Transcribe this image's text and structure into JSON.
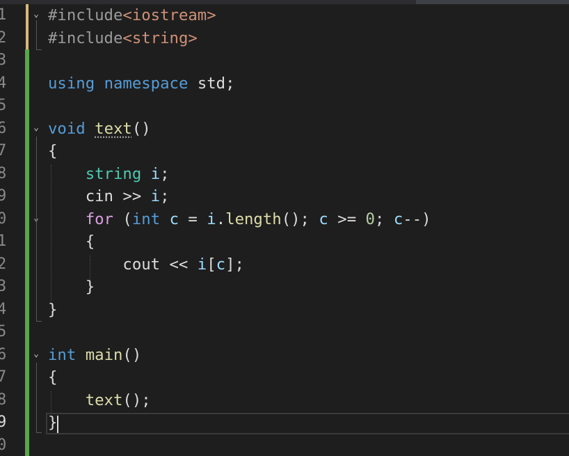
{
  "editor": {
    "language": "C++",
    "line_numbers": [
      "1",
      "2",
      "3",
      "4",
      "5",
      "6",
      "7",
      "8",
      "9",
      "0",
      "1",
      "2",
      "3",
      "4",
      "5",
      "6",
      "7",
      "8",
      "9",
      "0"
    ],
    "current_line_number_index": 18,
    "fold_toggle_glyph": "⌄",
    "lines": [
      [
        {
          "t": "#include",
          "c": "pp"
        },
        {
          "t": "<iostream>",
          "c": "include"
        }
      ],
      [
        {
          "t": "#include",
          "c": "pp"
        },
        {
          "t": "<string>",
          "c": "include"
        }
      ],
      [],
      [
        {
          "t": "using",
          "c": "kw"
        },
        {
          "t": " ",
          "c": "plain"
        },
        {
          "t": "namespace",
          "c": "kw"
        },
        {
          "t": " std;",
          "c": "plain"
        }
      ],
      [],
      [
        {
          "t": "void",
          "c": "kw"
        },
        {
          "t": " ",
          "c": "plain"
        },
        {
          "t": "text",
          "c": "fn squiggle"
        },
        {
          "t": "()",
          "c": "plain"
        }
      ],
      [
        {
          "t": "{",
          "c": "plain"
        }
      ],
      [
        {
          "t": "    ",
          "c": "plain"
        },
        {
          "t": "string",
          "c": "type"
        },
        {
          "t": " ",
          "c": "plain"
        },
        {
          "t": "i",
          "c": "var"
        },
        {
          "t": ";",
          "c": "plain"
        }
      ],
      [
        {
          "t": "    cin >> ",
          "c": "plain"
        },
        {
          "t": "i",
          "c": "var"
        },
        {
          "t": ";",
          "c": "plain"
        }
      ],
      [
        {
          "t": "    ",
          "c": "plain"
        },
        {
          "t": "for",
          "c": "ctrl"
        },
        {
          "t": " (",
          "c": "plain"
        },
        {
          "t": "int",
          "c": "kw"
        },
        {
          "t": " ",
          "c": "plain"
        },
        {
          "t": "c",
          "c": "var"
        },
        {
          "t": " = ",
          "c": "plain"
        },
        {
          "t": "i",
          "c": "var"
        },
        {
          "t": ".",
          "c": "plain"
        },
        {
          "t": "length",
          "c": "fn"
        },
        {
          "t": "(); ",
          "c": "plain"
        },
        {
          "t": "c",
          "c": "var"
        },
        {
          "t": " >= ",
          "c": "plain"
        },
        {
          "t": "0",
          "c": "num"
        },
        {
          "t": "; ",
          "c": "plain"
        },
        {
          "t": "c",
          "c": "var"
        },
        {
          "t": "--)",
          "c": "plain"
        }
      ],
      [
        {
          "t": "    {",
          "c": "plain"
        }
      ],
      [
        {
          "t": "        cout << ",
          "c": "plain"
        },
        {
          "t": "i",
          "c": "var"
        },
        {
          "t": "[",
          "c": "plain"
        },
        {
          "t": "c",
          "c": "var"
        },
        {
          "t": "];",
          "c": "plain"
        }
      ],
      [
        {
          "t": "    }",
          "c": "plain"
        }
      ],
      [
        {
          "t": "}",
          "c": "plain"
        }
      ],
      [],
      [
        {
          "t": "int",
          "c": "kw"
        },
        {
          "t": " ",
          "c": "plain"
        },
        {
          "t": "main",
          "c": "fn"
        },
        {
          "t": "()",
          "c": "plain"
        }
      ],
      [
        {
          "t": "{",
          "c": "plain"
        }
      ],
      [
        {
          "t": "    ",
          "c": "plain"
        },
        {
          "t": "text",
          "c": "fn"
        },
        {
          "t": "();",
          "c": "plain"
        }
      ],
      [
        {
          "t": "}",
          "c": "plain"
        }
      ],
      []
    ],
    "fold_toggle_lines": [
      0,
      5,
      9,
      15
    ],
    "colors": {
      "background": "#1e1e1e",
      "keyword": "#569cd6",
      "control": "#d8a0df",
      "type": "#4ec9b0",
      "function": "#dcdcaa",
      "variable": "#9cdcfe",
      "string": "#ce9178",
      "number": "#b5cea8",
      "preprocessor": "#9b9b9b",
      "text": "#dcdcdc",
      "saved_change_bar": "#57a64a",
      "unsaved_change_bar": "#d7ba7d"
    }
  }
}
